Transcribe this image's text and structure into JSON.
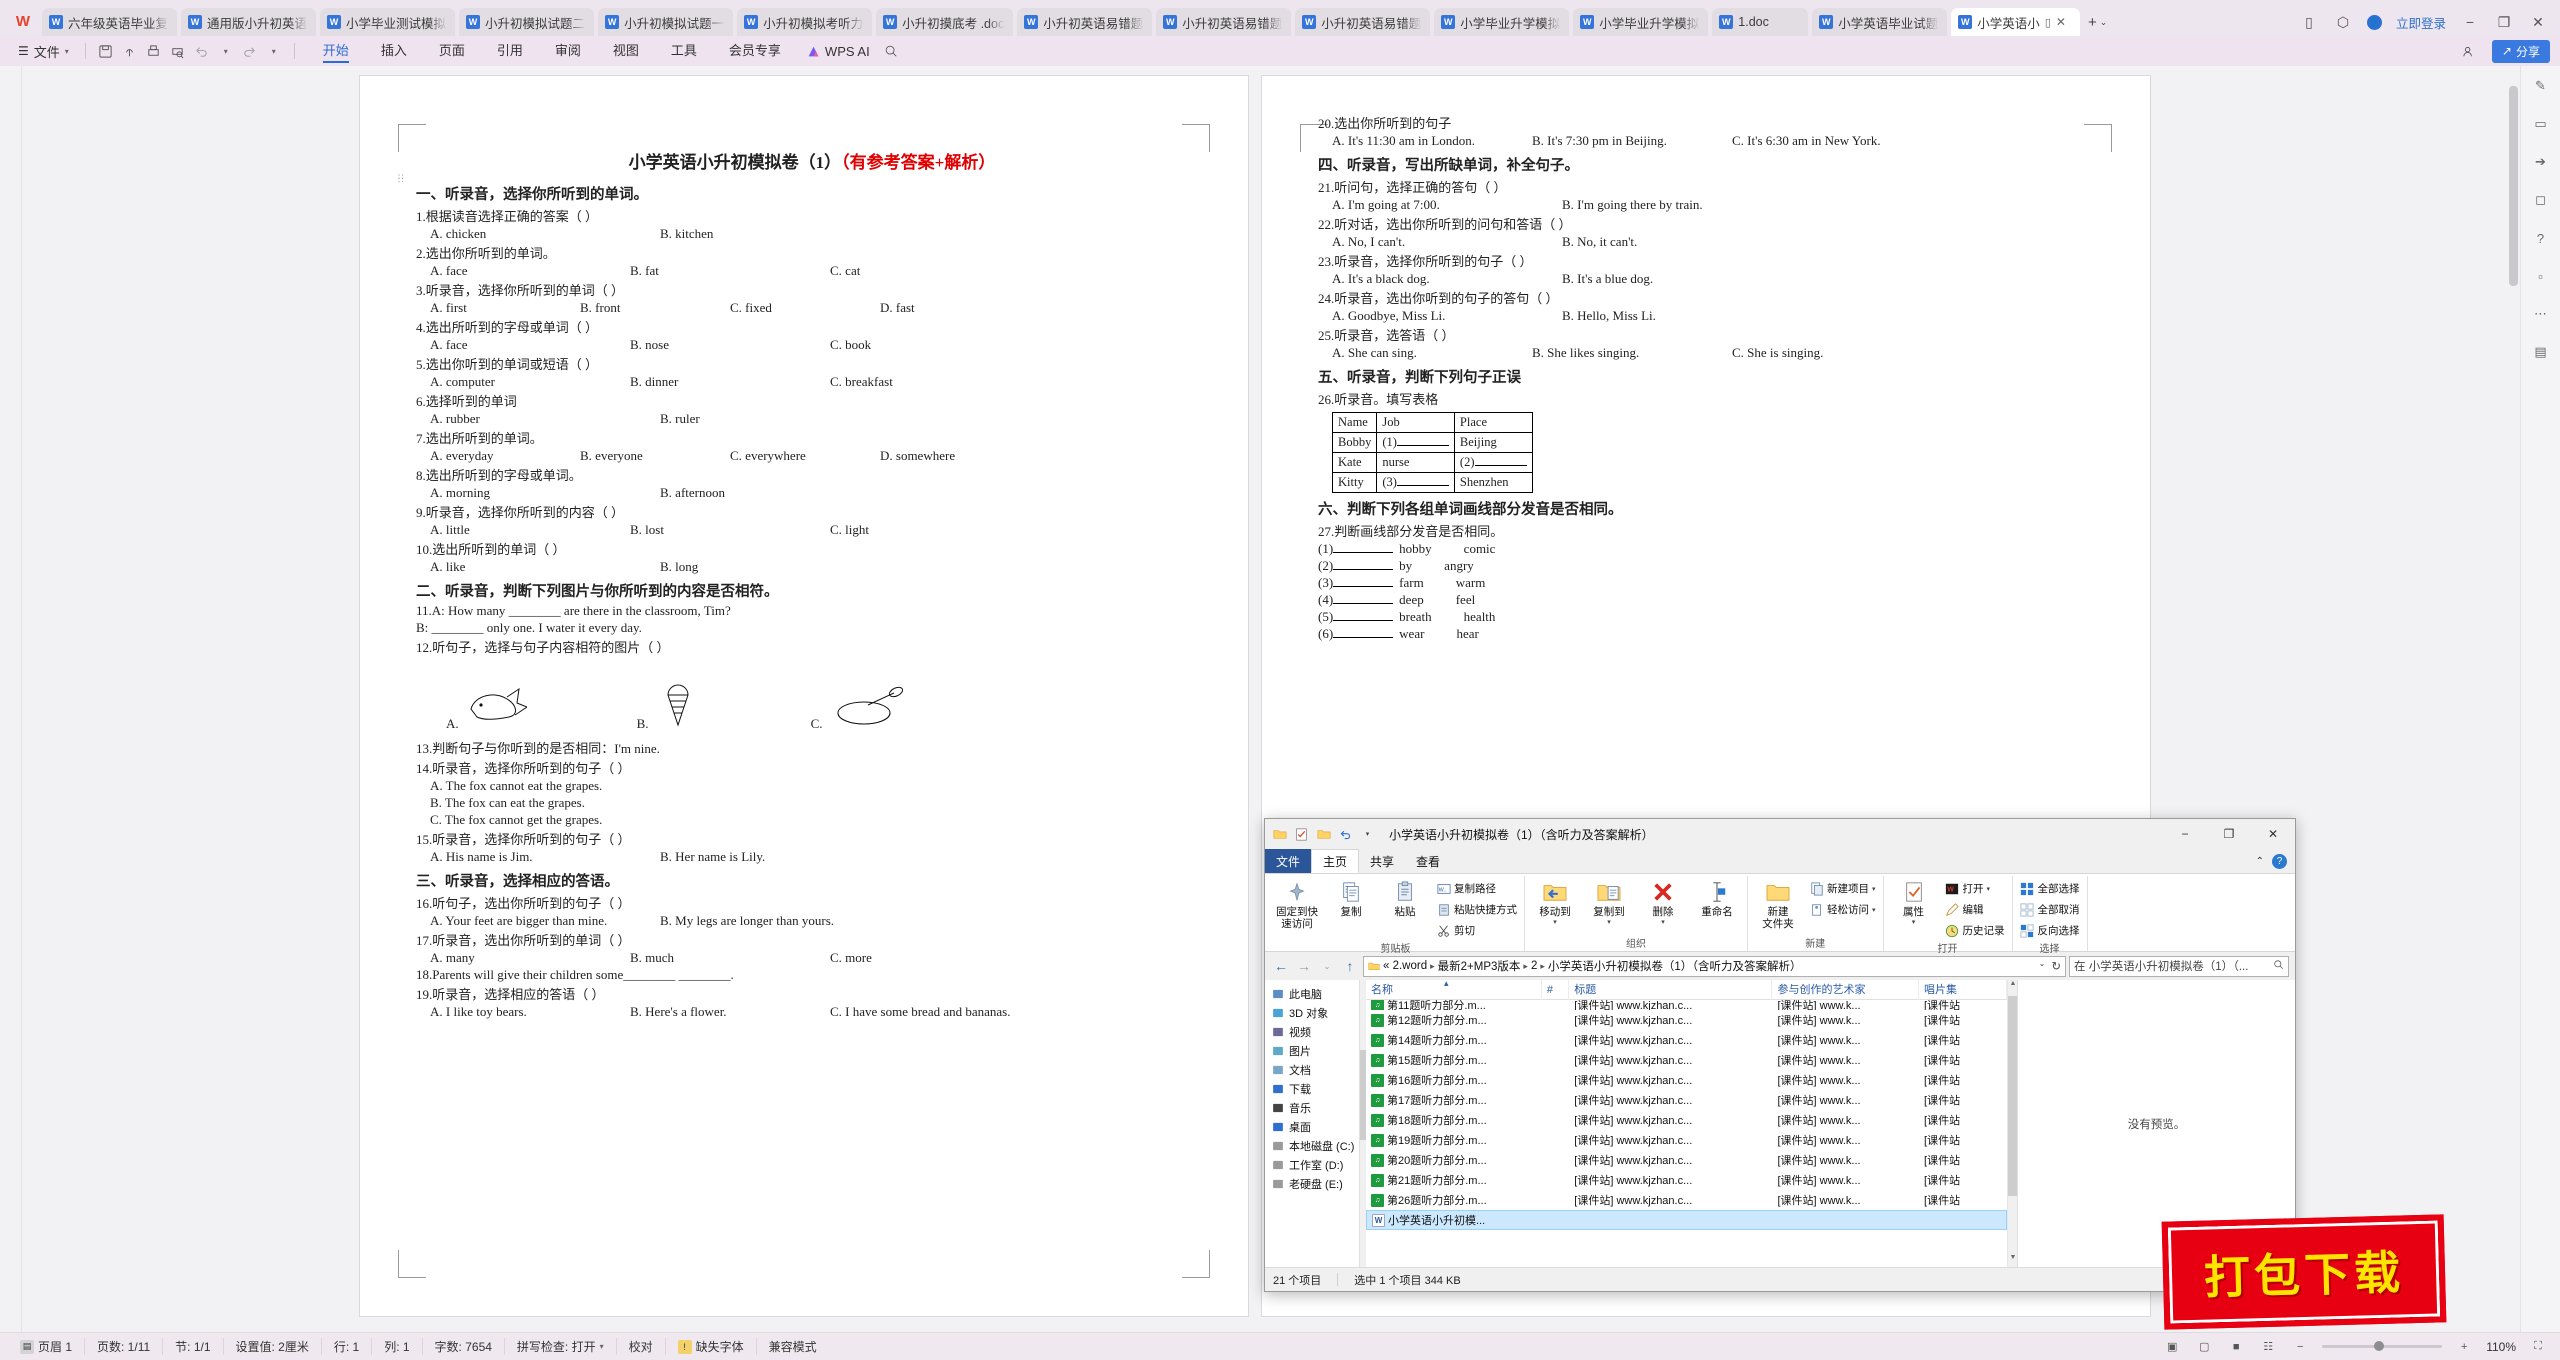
{
  "tabstrip": {
    "logo": "W",
    "tabs": [
      {
        "label": "六年级英语毕业复",
        "icon": "word-file-icon"
      },
      {
        "label": "通用版小升初英语",
        "icon": "word-file-icon"
      },
      {
        "label": "小学毕业测试模拟",
        "icon": "word-file-icon"
      },
      {
        "label": "小升初模拟试题二",
        "icon": "word-file-icon"
      },
      {
        "label": "小升初模拟试题一",
        "icon": "word-file-icon"
      },
      {
        "label": "小升初模拟考听力",
        "icon": "word-file-icon"
      },
      {
        "label": "小升初摸底考 .doc",
        "icon": "word-file-icon"
      },
      {
        "label": "小升初英语易错题",
        "icon": "word-file-icon"
      },
      {
        "label": "小升初英语易错题",
        "icon": "word-file-icon"
      },
      {
        "label": "小升初英语易错题",
        "icon": "word-file-icon"
      },
      {
        "label": "小学毕业升学模拟",
        "icon": "word-file-icon"
      },
      {
        "label": "小学毕业升学模拟",
        "icon": "word-file-icon"
      },
      {
        "label": "1.doc",
        "icon": "word-file-icon"
      },
      {
        "label": "小学英语毕业试题",
        "icon": "word-file-icon"
      },
      {
        "label": "小学英语小",
        "icon": "word-file-icon",
        "active": true
      }
    ],
    "new_tab": "+",
    "new_tab_caret": "⌄",
    "login_label": "立即登录",
    "minimize": "−",
    "maximize": "❐",
    "close": "✕"
  },
  "ribbon": {
    "file_menu": "文件",
    "tabs": [
      "开始",
      "插入",
      "页面",
      "引用",
      "审阅",
      "视图",
      "工具",
      "会员专享"
    ],
    "active_tab": "开始",
    "ai_label": "WPS AI",
    "share_label": "分享"
  },
  "document": {
    "title_black": "小学英语小升初模拟卷（1）",
    "title_red": "（有参考答案+解析）",
    "page1": [
      {
        "type": "sec",
        "text": "一、听录音，选择你所听到的单词。"
      },
      {
        "type": "q",
        "text": "1.根据读音选择正确的答案（  ）"
      },
      {
        "type": "opts",
        "items": [
          "A. chicken",
          "B. kitchen"
        ]
      },
      {
        "type": "q",
        "text": "2.选出你所听到的单词。"
      },
      {
        "type": "opts",
        "items": [
          "A. face",
          "B. fat",
          "C. cat"
        ]
      },
      {
        "type": "q",
        "text": "3.听录音，选择你所听到的单词（  ）"
      },
      {
        "type": "opts",
        "items": [
          "A. first",
          "B. front",
          "C. fixed",
          "D. fast"
        ]
      },
      {
        "type": "q",
        "text": "4.选出所听到的字母或单词（  ）"
      },
      {
        "type": "opts",
        "items": [
          "A. face",
          "B. nose",
          "C. book"
        ]
      },
      {
        "type": "q",
        "text": "5.选出你听到的单词或短语（  ）"
      },
      {
        "type": "opts",
        "items": [
          "A. computer",
          "B. dinner",
          "C. breakfast"
        ]
      },
      {
        "type": "q",
        "text": "6.选择听到的单词"
      },
      {
        "type": "opts",
        "items": [
          "A. rubber",
          "B. ruler"
        ]
      },
      {
        "type": "q",
        "text": "7.选出所听到的单词。"
      },
      {
        "type": "opts",
        "items": [
          "A. everyday",
          "B. everyone",
          "C. everywhere",
          "D. somewhere"
        ]
      },
      {
        "type": "q",
        "text": "8.选出所听到的字母或单词。"
      },
      {
        "type": "opts",
        "items": [
          "A. morning",
          "B. afternoon"
        ]
      },
      {
        "type": "q",
        "text": "9.听录音，选择你所听到的内容（  ）"
      },
      {
        "type": "opts",
        "items": [
          "A. little",
          "B. lost",
          "C. light"
        ]
      },
      {
        "type": "q",
        "text": "10.选出所听到的单词（  ）"
      },
      {
        "type": "opts",
        "items": [
          "A. like",
          "B. long"
        ]
      },
      {
        "type": "sec",
        "text": "二、听录音，判断下列图片与你所听到的内容是否相符。"
      },
      {
        "type": "q",
        "text": "11.A: How many ________ are there in the classroom, Tim?"
      },
      {
        "type": "q",
        "text": "B: ________ only one. I water it every day."
      },
      {
        "type": "q",
        "text": "12.听句子，选择与句子内容相符的图片（  ）"
      },
      {
        "type": "images",
        "labels": [
          "A.",
          "B.",
          "C."
        ]
      },
      {
        "type": "q",
        "text": "13.判断句子与你听到的是否相同：I'm nine."
      },
      {
        "type": "q",
        "text": "14.听录音，选择你所听到的句子（  ）"
      },
      {
        "type": "opts",
        "items": [
          "A. The fox cannot eat the grapes."
        ]
      },
      {
        "type": "opts",
        "items": [
          "B. The fox can eat the grapes."
        ]
      },
      {
        "type": "opts",
        "items": [
          "C. The fox cannot get the grapes."
        ]
      },
      {
        "type": "q",
        "text": "15.听录音，选择你所听到的句子（  ）"
      },
      {
        "type": "opts",
        "items": [
          "A. His name is Jim.",
          "B. Her name is Lily."
        ]
      },
      {
        "type": "sec",
        "text": "三、听录音，选择相应的答语。"
      },
      {
        "type": "q",
        "text": "16.听句子，选出你所听到的句子（  ）"
      },
      {
        "type": "opts",
        "items": [
          "A. Your feet are bigger than mine.",
          "B. My legs are longer than yours."
        ]
      },
      {
        "type": "q",
        "text": "17.听录音，选出你所听到的单词（  ）"
      },
      {
        "type": "opts",
        "items": [
          "A. many",
          "B. much",
          "C. more"
        ]
      },
      {
        "type": "q",
        "text": "18.Parents will give their children some________ ________."
      },
      {
        "type": "q",
        "text": "19.听录音，选择相应的答语（  ）"
      },
      {
        "type": "opts",
        "items": [
          "A. I like toy bears.",
          "B. Here's a flower.",
          "C. I have some bread and bananas."
        ]
      }
    ],
    "page2": [
      {
        "type": "q",
        "text": "20.选出你所听到的句子"
      },
      {
        "type": "opts",
        "items": [
          "A. It's 11:30 am in London.",
          "B. It's 7:30 pm in Beijing.",
          "C. It's 6:30 am in New York."
        ]
      },
      {
        "type": "sec",
        "text": "四、听录音，写出所缺单词，补全句子。"
      },
      {
        "type": "q",
        "text": "21.听问句，选择正确的答句（  ）"
      },
      {
        "type": "opts",
        "items": [
          "A. I'm going at 7:00.",
          "B. I'm going there by train."
        ]
      },
      {
        "type": "q",
        "text": "22.听对话，选出你所听到的问句和答语（  ）"
      },
      {
        "type": "opts",
        "items": [
          "A. No, I can't.",
          "B. No, it can't."
        ]
      },
      {
        "type": "q",
        "text": "23.听录音，选择你所听到的句子（  ）"
      },
      {
        "type": "opts",
        "items": [
          "A. It's a black dog.",
          "B. It's a blue dog."
        ]
      },
      {
        "type": "q",
        "text": "24.听录音，选出你听到的句子的答句（  ）"
      },
      {
        "type": "opts",
        "items": [
          "A. Goodbye, Miss Li.",
          "B. Hello, Miss Li."
        ]
      },
      {
        "type": "q",
        "text": "25.听录音，选答语（  ）"
      },
      {
        "type": "opts",
        "items": [
          "A. She can sing.",
          "B. She likes singing.",
          "C. She is singing."
        ]
      },
      {
        "type": "sec",
        "text": "五、听录音，判断下列句子正误"
      },
      {
        "type": "q",
        "text": "26.听录音。填写表格"
      },
      {
        "type": "table",
        "headers": [
          "Name",
          "Job",
          "Place"
        ],
        "rows": [
          [
            "Bobby",
            "(1)",
            "Beijing"
          ],
          [
            "Kate",
            "nurse",
            "(2)"
          ],
          [
            "Kitty",
            "(3)",
            "Shenzhen"
          ]
        ]
      },
      {
        "type": "sec",
        "text": "六、判断下列各组单词画线部分发音是否相同。"
      },
      {
        "type": "q",
        "text": "27.判断画线部分发音是否相同。"
      },
      {
        "type": "fill",
        "no": "(1)",
        "w1": "hobby",
        "w2": "comic"
      },
      {
        "type": "fill",
        "no": "(2)",
        "w1": "by",
        "w2": "angry"
      },
      {
        "type": "fill",
        "no": "(3)",
        "w1": "farm",
        "w2": "warm"
      },
      {
        "type": "fill",
        "no": "(4)",
        "w1": "deep",
        "w2": "feel"
      },
      {
        "type": "fill",
        "no": "(5)",
        "w1": "breath",
        "w2": "health"
      },
      {
        "type": "fill",
        "no": "(6)",
        "w1": "wear",
        "w2": "hear"
      }
    ]
  },
  "explorer": {
    "title": "小学英语小升初模拟卷（1）（含听力及答案解析）",
    "minimize": "−",
    "maximize": "❐",
    "close": "✕",
    "tabs": [
      "文件",
      "主页",
      "共享",
      "查看"
    ],
    "active_tab": "主页",
    "collapse_caret": "⌃",
    "help": "?",
    "groups": [
      {
        "name": "剪贴板",
        "big": [
          {
            "label": "固定到快\n速访问",
            "icon": "pin-icon"
          },
          {
            "label": "复制",
            "icon": "copy-icon"
          },
          {
            "label": "粘贴",
            "icon": "paste-icon"
          }
        ],
        "small": [
          {
            "label": "复制路径",
            "icon": "copy-path-icon"
          },
          {
            "label": "粘贴快捷方式",
            "icon": "paste-shortcut-icon"
          },
          {
            "label": "剪切",
            "icon": "scissors-icon"
          }
        ]
      },
      {
        "name": "组织",
        "big": [
          {
            "label": "移动到",
            "icon": "move-to-icon",
            "caret": true
          },
          {
            "label": "复制到",
            "icon": "copy-to-icon",
            "caret": true
          },
          {
            "label": "删除",
            "icon": "delete-icon",
            "caret": true
          },
          {
            "label": "重命名",
            "icon": "rename-icon"
          }
        ],
        "small": []
      },
      {
        "name": "新建",
        "big": [
          {
            "label": "新建\n文件夹",
            "icon": "new-folder-icon"
          }
        ],
        "small": [
          {
            "label": "新建项目",
            "icon": "new-item-icon",
            "caret": true
          },
          {
            "label": "轻松访问",
            "icon": "easy-access-icon",
            "caret": true
          }
        ]
      },
      {
        "name": "打开",
        "big": [
          {
            "label": "属性",
            "icon": "properties-icon",
            "caret": true
          }
        ],
        "small": [
          {
            "label": "打开",
            "icon": "open-icon",
            "caret": true
          },
          {
            "label": "编辑",
            "icon": "edit-icon"
          },
          {
            "label": "历史记录",
            "icon": "history-icon"
          }
        ]
      },
      {
        "name": "选择",
        "big": [],
        "small": [
          {
            "label": "全部选择",
            "icon": "select-all-icon"
          },
          {
            "label": "全部取消",
            "icon": "select-none-icon"
          },
          {
            "label": "反向选择",
            "icon": "invert-selection-icon"
          }
        ]
      }
    ],
    "nav": {
      "back": "←",
      "forward": "→",
      "recent": "⌄",
      "up": "↑",
      "refresh": "↻",
      "dropdown": "⌄"
    },
    "breadcrumb": [
      "« 2.word",
      "最新2+MP3版本",
      "2",
      "小学英语小升初模拟卷（1）（含听力及答案解析）"
    ],
    "search_placeholder": "在 小学英语小升初模拟卷（1）（...",
    "sidebar": [
      {
        "label": "此电脑",
        "icon": "this-pc-icon"
      },
      {
        "label": "3D 对象",
        "icon": "3d-objects-icon"
      },
      {
        "label": "视频",
        "icon": "videos-icon"
      },
      {
        "label": "图片",
        "icon": "pictures-icon"
      },
      {
        "label": "文档",
        "icon": "documents-icon"
      },
      {
        "label": "下载",
        "icon": "downloads-icon"
      },
      {
        "label": "音乐",
        "icon": "music-icon"
      },
      {
        "label": "桌面",
        "icon": "desktop-icon"
      },
      {
        "label": "本地磁盘 (C:)",
        "icon": "disk-icon"
      },
      {
        "label": "工作室 (D:)",
        "icon": "disk-icon"
      },
      {
        "label": "老硬盘 (E:)",
        "icon": "disk-icon"
      }
    ],
    "columns": [
      "名称",
      "#",
      "标题",
      "参与创作的艺术家",
      "唱片集"
    ],
    "files": [
      {
        "name": "第11题听力部分.m...",
        "num": "",
        "title": "[课件站] www.kjzhan.c...",
        "artist": "[课件站] www.k...",
        "album": "[课件站",
        "icon": "mp3-icon",
        "partial": true
      },
      {
        "name": "第12题听力部分.m...",
        "num": "",
        "title": "[课件站] www.kjzhan.c...",
        "artist": "[课件站] www.k...",
        "album": "[课件站",
        "icon": "mp3-icon"
      },
      {
        "name": "第14题听力部分.m...",
        "num": "",
        "title": "[课件站] www.kjzhan.c...",
        "artist": "[课件站] www.k...",
        "album": "[课件站",
        "icon": "mp3-icon"
      },
      {
        "name": "第15题听力部分.m...",
        "num": "",
        "title": "[课件站] www.kjzhan.c...",
        "artist": "[课件站] www.k...",
        "album": "[课件站",
        "icon": "mp3-icon"
      },
      {
        "name": "第16题听力部分.m...",
        "num": "",
        "title": "[课件站] www.kjzhan.c...",
        "artist": "[课件站] www.k...",
        "album": "[课件站",
        "icon": "mp3-icon"
      },
      {
        "name": "第17题听力部分.m...",
        "num": "",
        "title": "[课件站] www.kjzhan.c...",
        "artist": "[课件站] www.k...",
        "album": "[课件站",
        "icon": "mp3-icon"
      },
      {
        "name": "第18题听力部分.m...",
        "num": "",
        "title": "[课件站] www.kjzhan.c...",
        "artist": "[课件站] www.k...",
        "album": "[课件站",
        "icon": "mp3-icon"
      },
      {
        "name": "第19题听力部分.m...",
        "num": "",
        "title": "[课件站] www.kjzhan.c...",
        "artist": "[课件站] www.k...",
        "album": "[课件站",
        "icon": "mp3-icon"
      },
      {
        "name": "第20题听力部分.m...",
        "num": "",
        "title": "[课件站] www.kjzhan.c...",
        "artist": "[课件站] www.k...",
        "album": "[课件站",
        "icon": "mp3-icon"
      },
      {
        "name": "第21题听力部分.m...",
        "num": "",
        "title": "[课件站] www.kjzhan.c...",
        "artist": "[课件站] www.k...",
        "album": "[课件站",
        "icon": "mp3-icon"
      },
      {
        "name": "第26题听力部分.m...",
        "num": "",
        "title": "[课件站] www.kjzhan.c...",
        "artist": "[课件站] www.k...",
        "album": "[课件站",
        "icon": "mp3-icon"
      },
      {
        "name": "小学英语小升初模...",
        "num": "",
        "title": "",
        "artist": "",
        "album": "",
        "icon": "word-doc-icon",
        "selected": true
      }
    ],
    "preview_text": "没有预览。",
    "status": {
      "count": "21 个项目",
      "selected": "选中 1 个项目  344 KB"
    }
  },
  "stamp": {
    "text": "打包下载"
  },
  "statusbar": {
    "items": [
      {
        "label": "页眉 1",
        "icon": "header-icon"
      },
      {
        "label": "页数: 1/11"
      },
      {
        "label": "节: 1/1"
      },
      {
        "label": "设置值: 2厘米"
      },
      {
        "label": "行: 1"
      },
      {
        "label": "列: 1"
      },
      {
        "label": "字数: 7654"
      },
      {
        "label": "拼写检查: 打开",
        "caret": "⌄"
      },
      {
        "label": "校对"
      },
      {
        "label": "缺失字体",
        "icon": "warn-icon"
      },
      {
        "label": "兼容模式"
      }
    ],
    "zoom": "110%",
    "zoom_minus": "−",
    "zoom_plus": "+"
  }
}
